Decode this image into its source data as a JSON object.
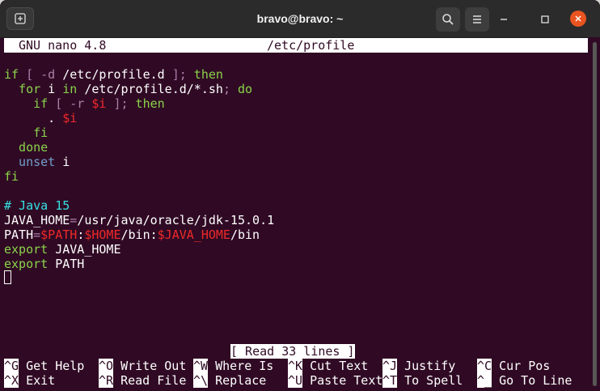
{
  "window": {
    "title": "bravo@bravo: ~",
    "accent_close": "#e95420",
    "terminal_bg": "#300a24"
  },
  "titlebar_icons": [
    "new-tab-icon",
    "search-icon",
    "hamburger-menu-icon",
    "minimize-icon",
    "maximize-icon",
    "close-icon"
  ],
  "nano": {
    "version": "GNU nano 4.8",
    "filename": "/etc/profile",
    "status_message": "[ Read 33 lines ]"
  },
  "lines": [
    {
      "segments": [
        [
          "if",
          "kw"
        ],
        [
          " [ ",
          "op"
        ],
        [
          "-d",
          "op"
        ],
        [
          " /etc/profile.d ",
          "ptext"
        ],
        [
          "];",
          "op"
        ],
        [
          " then",
          "kw"
        ]
      ]
    },
    {
      "segments": [
        [
          "  for",
          "kw"
        ],
        [
          " i ",
          "ptext"
        ],
        [
          "in",
          "kw"
        ],
        [
          " /etc/profile.d/*.sh",
          "ptext"
        ],
        [
          ";",
          "op"
        ],
        [
          " do",
          "kw"
        ]
      ]
    },
    {
      "segments": [
        [
          "    if",
          "kw"
        ],
        [
          " [ ",
          "op"
        ],
        [
          "-r",
          "op"
        ],
        [
          " ",
          "ptext"
        ],
        [
          "$i",
          "var"
        ],
        [
          " ];",
          "op"
        ],
        [
          " then",
          "kw"
        ]
      ]
    },
    {
      "segments": [
        [
          "      . ",
          "ptext"
        ],
        [
          "$i",
          "var"
        ]
      ]
    },
    {
      "segments": [
        [
          "    fi",
          "kw"
        ]
      ]
    },
    {
      "segments": [
        [
          "  done",
          "kw"
        ]
      ]
    },
    {
      "segments": [
        [
          "  unset",
          "blue"
        ],
        [
          " i",
          "ptext"
        ]
      ]
    },
    {
      "segments": [
        [
          "fi",
          "kw"
        ]
      ]
    },
    {
      "segments": []
    },
    {
      "segments": [
        [
          "# Java 15",
          "comment"
        ]
      ]
    },
    {
      "segments": [
        [
          "JAVA_HOME",
          "ptext"
        ],
        [
          "=",
          "op"
        ],
        [
          "/usr/java/oracle/jdk-15.0.1",
          "ptext"
        ]
      ]
    },
    {
      "segments": [
        [
          "PATH",
          "ptext"
        ],
        [
          "=",
          "op"
        ],
        [
          "$PATH",
          "var"
        ],
        [
          ":",
          "ptext"
        ],
        [
          "$HOME",
          "var"
        ],
        [
          "/bin:",
          "ptext"
        ],
        [
          "$JAVA_HOME",
          "var"
        ],
        [
          "/bin",
          "ptext"
        ]
      ]
    },
    {
      "segments": [
        [
          "export",
          "kw"
        ],
        [
          " JAVA_HOME",
          "ptext"
        ]
      ]
    },
    {
      "segments": [
        [
          "export",
          "kw"
        ],
        [
          " PATH",
          "ptext"
        ]
      ]
    }
  ],
  "shortcuts_row1": [
    {
      "key": "^G",
      "label": "Get Help"
    },
    {
      "key": "^O",
      "label": "Write Out"
    },
    {
      "key": "^W",
      "label": "Where Is"
    },
    {
      "key": "^K",
      "label": "Cut Text"
    },
    {
      "key": "^J",
      "label": "Justify"
    },
    {
      "key": "^C",
      "label": "Cur Pos"
    }
  ],
  "shortcuts_row2": [
    {
      "key": "^X",
      "label": "Exit"
    },
    {
      "key": "^R",
      "label": "Read File"
    },
    {
      "key": "^\\",
      "label": "Replace"
    },
    {
      "key": "^U",
      "label": "Paste Text"
    },
    {
      "key": "^T",
      "label": "To Spell"
    },
    {
      "key": "^_",
      "label": "Go To Line"
    }
  ]
}
